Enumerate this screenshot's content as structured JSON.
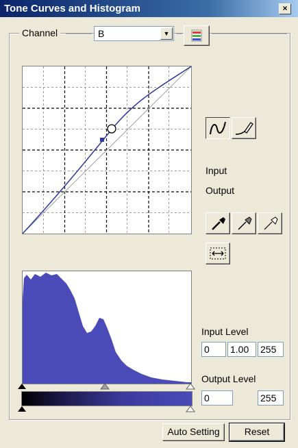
{
  "window": {
    "title": "Tone Curves and Histogram",
    "close_label": "×"
  },
  "channel": {
    "label": "Channel",
    "selected": "B"
  },
  "curve": {
    "input_label": "Input",
    "output_label": "Output"
  },
  "levels": {
    "input_label": "Input Level",
    "input_black": "0",
    "input_gamma": "1.00",
    "input_white": "255",
    "output_label": "Output Level",
    "output_black": "0",
    "output_white": "255"
  },
  "buttons": {
    "auto_setting": "Auto Setting",
    "reset": "Reset"
  },
  "colors": {
    "curve": "#2e3a9c",
    "histogram": "#4a4ab8",
    "accent": "#3b3b9e"
  },
  "icons": [
    "close-icon",
    "dropdown-arrow-icon",
    "rgb-channels-icon",
    "curve-mode-icon",
    "freehand-pencil-icon",
    "black-point-eyedropper-icon",
    "gray-point-eyedropper-icon",
    "white-point-eyedropper-icon",
    "curve-reset-icon"
  ]
}
